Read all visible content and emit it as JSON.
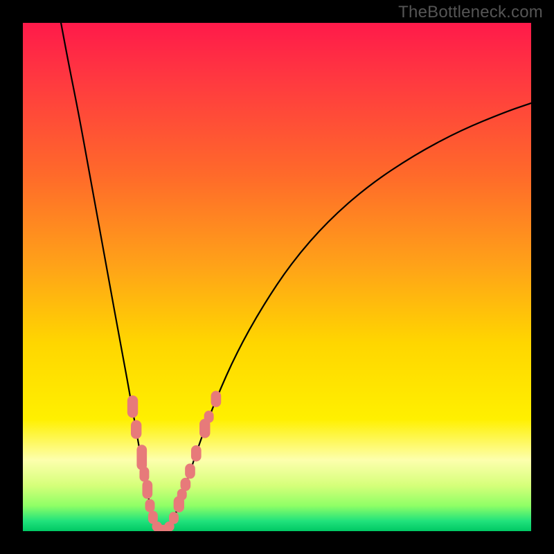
{
  "watermark": "TheBottleneck.com",
  "colors": {
    "background_black": "#000000",
    "curve_stroke": "#000000",
    "marker_fill": "#e77a7a",
    "gradient_stops": [
      {
        "offset": 0.0,
        "color": "#ff1a4a"
      },
      {
        "offset": 0.12,
        "color": "#ff3b3f"
      },
      {
        "offset": 0.3,
        "color": "#ff6a2a"
      },
      {
        "offset": 0.48,
        "color": "#ffa318"
      },
      {
        "offset": 0.63,
        "color": "#ffd600"
      },
      {
        "offset": 0.78,
        "color": "#fff000"
      },
      {
        "offset": 0.86,
        "color": "#fdffad"
      },
      {
        "offset": 0.91,
        "color": "#d6ff7a"
      },
      {
        "offset": 0.95,
        "color": "#8fff66"
      },
      {
        "offset": 0.98,
        "color": "#21e27c"
      },
      {
        "offset": 1.0,
        "color": "#00c864"
      }
    ]
  },
  "chart_data": {
    "type": "line",
    "title": "",
    "xlabel": "",
    "ylabel": "",
    "xlim": [
      0,
      100
    ],
    "ylim": [
      0,
      100
    ],
    "curve_description": "V-shaped bottleneck curve; steep descending left branch, flat minimum near x≈27, shallow ascending right branch",
    "curve": [
      {
        "x": 7.5,
        "y": 100.0
      },
      {
        "x": 9.0,
        "y": 92.0
      },
      {
        "x": 11.0,
        "y": 82.0
      },
      {
        "x": 13.0,
        "y": 71.0
      },
      {
        "x": 15.0,
        "y": 60.0
      },
      {
        "x": 17.0,
        "y": 49.0
      },
      {
        "x": 19.0,
        "y": 38.0
      },
      {
        "x": 20.5,
        "y": 30.0
      },
      {
        "x": 22.0,
        "y": 21.5
      },
      {
        "x": 23.5,
        "y": 13.0
      },
      {
        "x": 24.8,
        "y": 6.0
      },
      {
        "x": 25.8,
        "y": 1.8
      },
      {
        "x": 26.6,
        "y": 0.4
      },
      {
        "x": 28.2,
        "y": 0.4
      },
      {
        "x": 29.0,
        "y": 1.2
      },
      {
        "x": 30.0,
        "y": 3.2
      },
      {
        "x": 31.5,
        "y": 7.5
      },
      {
        "x": 33.0,
        "y": 12.0
      },
      {
        "x": 35.0,
        "y": 18.0
      },
      {
        "x": 38.0,
        "y": 26.0
      },
      {
        "x": 42.0,
        "y": 35.0
      },
      {
        "x": 47.0,
        "y": 44.0
      },
      {
        "x": 53.0,
        "y": 53.0
      },
      {
        "x": 60.0,
        "y": 61.0
      },
      {
        "x": 68.0,
        "y": 68.0
      },
      {
        "x": 77.0,
        "y": 74.0
      },
      {
        "x": 86.0,
        "y": 78.8
      },
      {
        "x": 95.0,
        "y": 82.5
      },
      {
        "x": 100.0,
        "y": 84.2
      }
    ],
    "markers_description": "Salmon-colored rounded capsule markers clustered on the lower parts of both branches near the trough",
    "markers": [
      {
        "x": 21.6,
        "y": 24.5,
        "w": 2.1,
        "h": 4.4
      },
      {
        "x": 22.3,
        "y": 20.0,
        "w": 2.1,
        "h": 3.7
      },
      {
        "x": 23.4,
        "y": 14.5,
        "w": 2.0,
        "h": 5.0
      },
      {
        "x": 23.9,
        "y": 11.2,
        "w": 1.9,
        "h": 3.0
      },
      {
        "x": 24.5,
        "y": 8.2,
        "w": 2.0,
        "h": 3.7
      },
      {
        "x": 25.0,
        "y": 5.0,
        "w": 1.9,
        "h": 2.6
      },
      {
        "x": 25.6,
        "y": 2.7,
        "w": 1.9,
        "h": 2.6
      },
      {
        "x": 26.4,
        "y": 0.9,
        "w": 2.0,
        "h": 2.0
      },
      {
        "x": 27.5,
        "y": 0.3,
        "w": 3.4,
        "h": 1.9
      },
      {
        "x": 28.8,
        "y": 0.9,
        "w": 2.0,
        "h": 2.0
      },
      {
        "x": 29.7,
        "y": 2.6,
        "w": 1.9,
        "h": 2.4
      },
      {
        "x": 30.7,
        "y": 5.3,
        "w": 2.1,
        "h": 3.2
      },
      {
        "x": 31.3,
        "y": 7.2,
        "w": 1.9,
        "h": 2.3
      },
      {
        "x": 32.0,
        "y": 9.2,
        "w": 2.0,
        "h": 2.6
      },
      {
        "x": 32.9,
        "y": 11.8,
        "w": 2.0,
        "h": 3.0
      },
      {
        "x": 34.1,
        "y": 15.3,
        "w": 2.0,
        "h": 3.2
      },
      {
        "x": 35.8,
        "y": 20.2,
        "w": 2.1,
        "h": 3.8
      },
      {
        "x": 36.6,
        "y": 22.5,
        "w": 1.9,
        "h": 2.4
      },
      {
        "x": 38.0,
        "y": 26.0,
        "w": 2.0,
        "h": 3.2
      }
    ]
  }
}
